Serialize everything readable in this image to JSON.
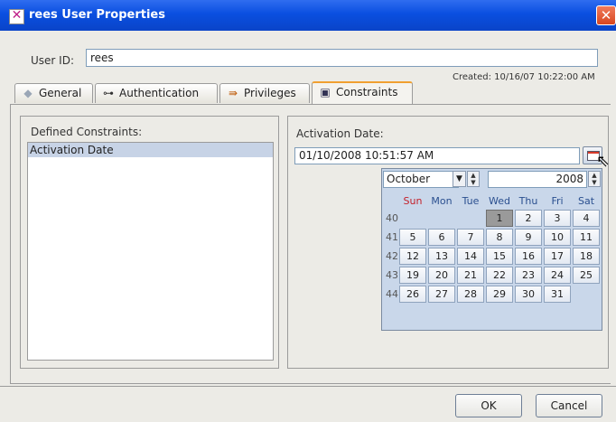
{
  "window": {
    "title": "rees User Properties",
    "close_glyph": "✕"
  },
  "user": {
    "id_label": "User ID:",
    "id_value": "rees",
    "created_text": "Created: 10/16/07 10:22:00 AM"
  },
  "tabs": [
    {
      "label": "General",
      "icon": "general-icon"
    },
    {
      "label": "Authentication",
      "icon": "key-icon"
    },
    {
      "label": "Privileges",
      "icon": "privileges-icon"
    },
    {
      "label": "Constraints",
      "icon": "constraints-icon",
      "active": true
    }
  ],
  "constraints": {
    "defined_label": "Defined Constraints:",
    "items": [
      "Activation Date"
    ],
    "selected_index": 0
  },
  "activation": {
    "label": "Activation Date:",
    "value": "01/10/2008 10:51:57 AM"
  },
  "calendar": {
    "month": "October",
    "year": "2008",
    "days_of_week": [
      "Sun",
      "Mon",
      "Tue",
      "Wed",
      "Thu",
      "Fri",
      "Sat"
    ],
    "selected_day": "1",
    "weeks": [
      {
        "num": "40",
        "days": [
          "",
          "",
          "",
          "1",
          "2",
          "3",
          "4"
        ]
      },
      {
        "num": "41",
        "days": [
          "5",
          "6",
          "7",
          "8",
          "9",
          "10",
          "11"
        ]
      },
      {
        "num": "42",
        "days": [
          "12",
          "13",
          "14",
          "15",
          "16",
          "17",
          "18"
        ]
      },
      {
        "num": "43",
        "days": [
          "19",
          "20",
          "21",
          "22",
          "23",
          "24",
          "25"
        ]
      },
      {
        "num": "44",
        "days": [
          "26",
          "27",
          "28",
          "29",
          "30",
          "31",
          ""
        ]
      }
    ]
  },
  "buttons": {
    "ok": "OK",
    "cancel": "Cancel"
  },
  "colors": {
    "titlebar": "#0a4fe0",
    "selection": "#c7d3e6",
    "sunday": "#c4202a",
    "weekday": "#2a4f8f"
  }
}
